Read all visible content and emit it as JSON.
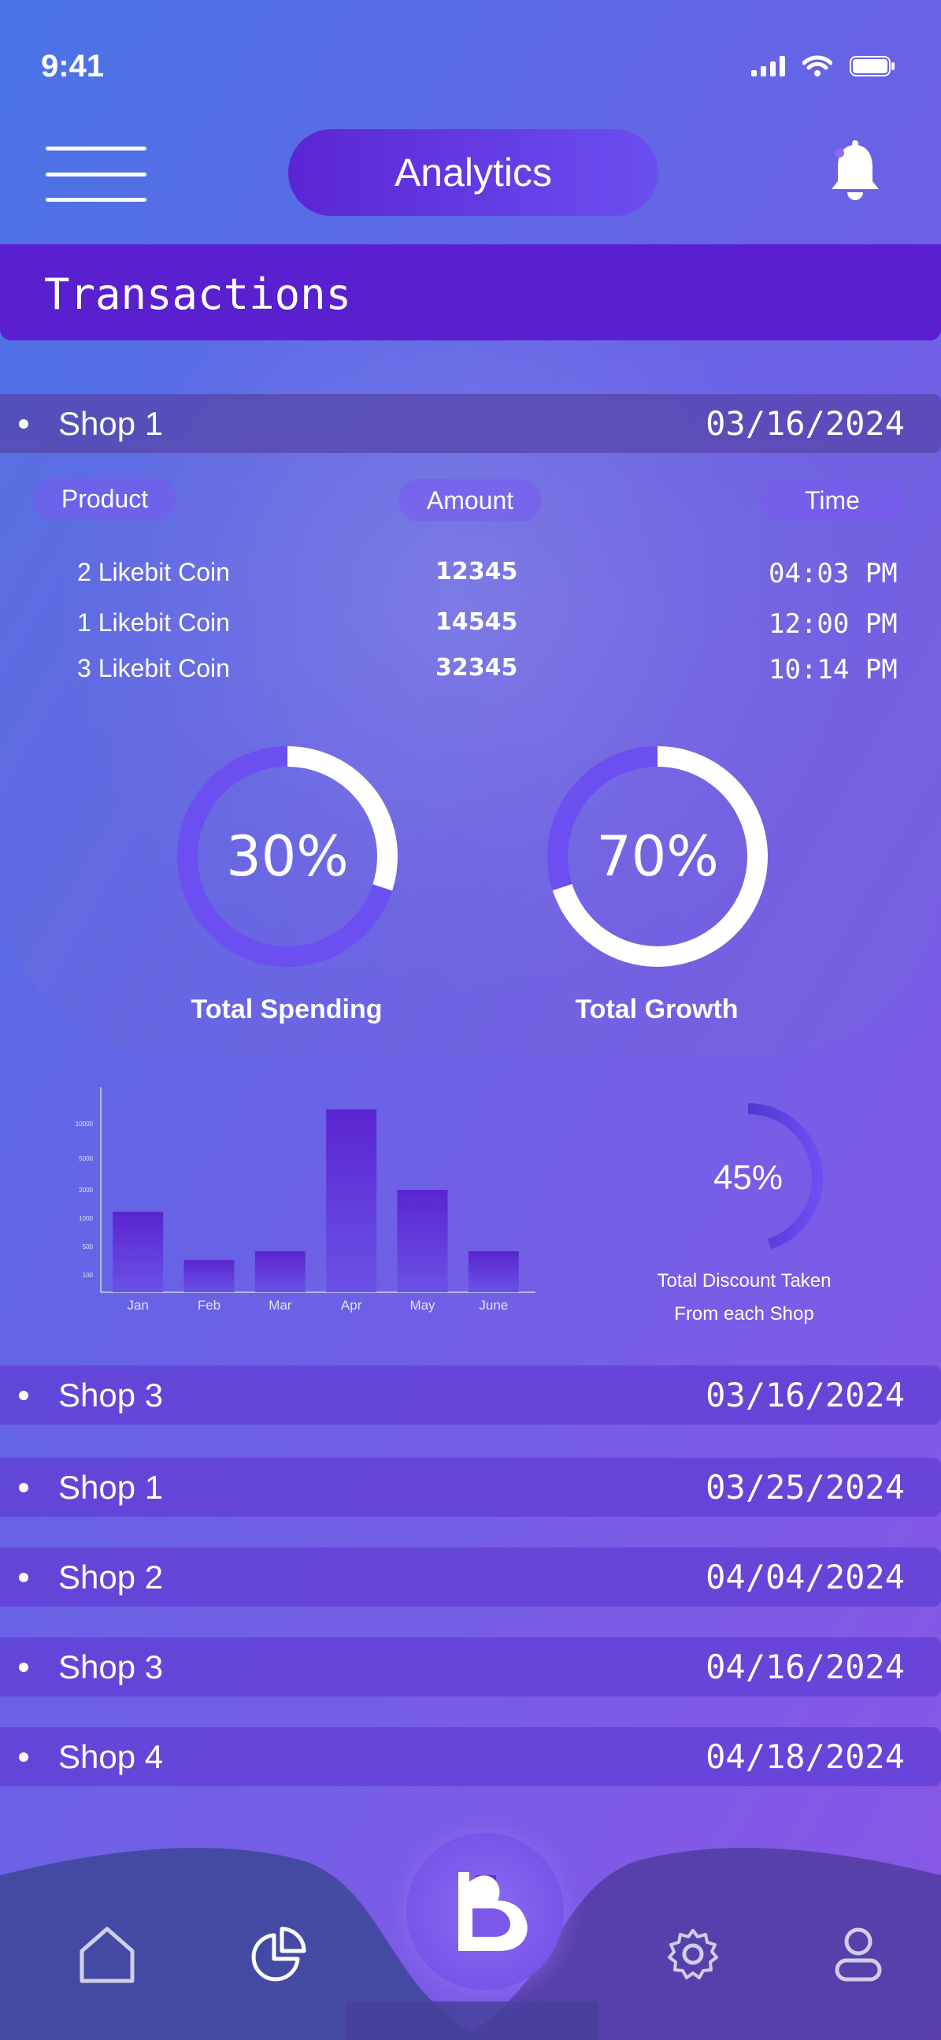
{
  "status_bar": {
    "time": "9:41"
  },
  "header": {
    "title": "Analytics"
  },
  "section": {
    "title": "Transactions"
  },
  "expanded_shop": {
    "name": "Shop 1",
    "date": "03/16/2024",
    "columns": {
      "product": "Product",
      "amount": "Amount",
      "time": "Time"
    },
    "rows": [
      {
        "product": "2 Likebit Coin",
        "amount": "12345",
        "time": "04:03 PM"
      },
      {
        "product": "1 Likebit Coin",
        "amount": "14545",
        "time": "12:00 PM"
      },
      {
        "product": "3 Likebit Coin",
        "amount": "32345",
        "time": "10:14 PM"
      }
    ],
    "rings": [
      {
        "value": 30,
        "value_text": "30%",
        "label": "Total Spending"
      },
      {
        "value": 70,
        "value_text": "70%",
        "label": "Total Growth"
      }
    ]
  },
  "chart_data": {
    "type": "bar",
    "categories": [
      "Jan",
      "Feb",
      "Mar",
      "Apr",
      "May",
      "June"
    ],
    "values": [
      5500,
      2200,
      2800,
      12500,
      7000,
      2800
    ],
    "y_ticks": [
      "100",
      "500",
      "1000",
      "2000",
      "5000",
      "10000"
    ],
    "ylim": [
      0,
      14000
    ],
    "title": "",
    "xlabel": "",
    "ylabel": ""
  },
  "discount": {
    "value": 45,
    "value_text": "45%",
    "label_line1": "Total Discount Taken",
    "label_line2": "From each Shop"
  },
  "shops": [
    {
      "name": "Shop 3",
      "date": "03/16/2024"
    },
    {
      "name": "Shop 1",
      "date": "03/25/2024"
    },
    {
      "name": "Shop 2",
      "date": "04/04/2024"
    },
    {
      "name": "Shop 3",
      "date": "04/16/2024"
    },
    {
      "name": "Shop 4",
      "date": "04/18/2024"
    }
  ],
  "nav": {
    "items": [
      "home-icon",
      "pie-chart-icon",
      "app-logo-icon",
      "settings-icon",
      "profile-icon"
    ],
    "active": "app-logo-icon"
  },
  "colors": {
    "accent": "#5a1fcf",
    "ring_track": "#6b4ff0",
    "ring_fill": "#ffffff",
    "bar": "#5a2fd6"
  }
}
